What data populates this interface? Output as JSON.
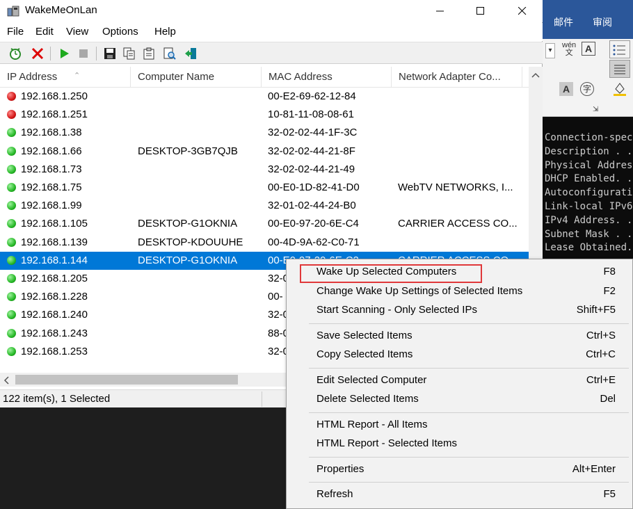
{
  "window": {
    "title": "WakeMeOnLan"
  },
  "menu": [
    "File",
    "Edit",
    "View",
    "Options",
    "Help"
  ],
  "toolbar": [
    "options-icon",
    "delete-icon",
    "play-icon",
    "stop-icon",
    "save-icon",
    "copy-icon",
    "properties-icon",
    "find-icon",
    "exit-icon"
  ],
  "columns": [
    "IP Address",
    "Computer Name",
    "MAC Address",
    "Network Adapter Co..."
  ],
  "rows": [
    {
      "status": "red",
      "ip": "192.168.1.250",
      "name": "",
      "mac": "00-E2-69-62-12-84",
      "adapter": ""
    },
    {
      "status": "red",
      "ip": "192.168.1.251",
      "name": "",
      "mac": "10-81-11-08-08-61",
      "adapter": ""
    },
    {
      "status": "green",
      "ip": "192.168.1.38",
      "name": "",
      "mac": "32-02-02-44-1F-3C",
      "adapter": ""
    },
    {
      "status": "green",
      "ip": "192.168.1.66",
      "name": "DESKTOP-3GB7QJB",
      "mac": "32-02-02-44-21-8F",
      "adapter": ""
    },
    {
      "status": "green",
      "ip": "192.168.1.73",
      "name": "",
      "mac": "32-02-02-44-21-49",
      "adapter": ""
    },
    {
      "status": "green",
      "ip": "192.168.1.75",
      "name": "",
      "mac": "00-E0-1D-82-41-D0",
      "adapter": "WebTV NETWORKS, I..."
    },
    {
      "status": "green",
      "ip": "192.168.1.99",
      "name": "",
      "mac": "32-01-02-44-24-B0",
      "adapter": ""
    },
    {
      "status": "green",
      "ip": "192.168.1.105",
      "name": "DESKTOP-G1OKNIA",
      "mac": "00-E0-97-20-6E-C4",
      "adapter": "CARRIER ACCESS CO..."
    },
    {
      "status": "green",
      "ip": "192.168.1.139",
      "name": "DESKTOP-KDOUUHE",
      "mac": "00-4D-9A-62-C0-71",
      "adapter": ""
    },
    {
      "status": "green",
      "ip": "192.168.1.144",
      "name": "DESKTOP-G1OKNIA",
      "mac": "00-E0-97-20-6E-C2",
      "adapter": "CARRIER ACCESS CO...",
      "selected": true
    },
    {
      "status": "green",
      "ip": "192.168.1.205",
      "name": "",
      "mac": "32-0",
      "adapter": ""
    },
    {
      "status": "green",
      "ip": "192.168.1.228",
      "name": "",
      "mac": "00-",
      "adapter": ""
    },
    {
      "status": "green",
      "ip": "192.168.1.240",
      "name": "",
      "mac": "32-0",
      "adapter": ""
    },
    {
      "status": "green",
      "ip": "192.168.1.243",
      "name": "",
      "mac": "88-0",
      "adapter": ""
    },
    {
      "status": "green",
      "ip": "192.168.1.253",
      "name": "",
      "mac": "32-0",
      "adapter": ""
    }
  ],
  "status": {
    "text": "122 item(s), 1 Selected"
  },
  "context_menu": [
    {
      "label": "Wake Up Selected Computers",
      "shortcut": "F8",
      "highlighted": true
    },
    {
      "label": "Change Wake Up Settings of Selected Items",
      "shortcut": "F2"
    },
    {
      "label": "Start Scanning - Only Selected IPs",
      "shortcut": "Shift+F5"
    },
    {
      "sep": true
    },
    {
      "label": "Save Selected Items",
      "shortcut": "Ctrl+S"
    },
    {
      "label": "Copy Selected Items",
      "shortcut": "Ctrl+C"
    },
    {
      "sep": true
    },
    {
      "label": "Edit Selected Computer",
      "shortcut": "Ctrl+E"
    },
    {
      "label": "Delete Selected Items",
      "shortcut": "Del"
    },
    {
      "sep": true
    },
    {
      "label": "HTML Report - All Items",
      "shortcut": ""
    },
    {
      "label": "HTML Report - Selected Items",
      "shortcut": ""
    },
    {
      "sep": true
    },
    {
      "label": "Properties",
      "shortcut": "Alt+Enter"
    },
    {
      "sep": true
    },
    {
      "label": "Refresh",
      "shortcut": "F5"
    }
  ],
  "background_app": {
    "tabs": [
      "邮件",
      "审阅"
    ],
    "console_lines": [
      "Connection-spec",
      "Description . .",
      "Physical Addres",
      "DHCP Enabled. .",
      "Autoconfigurati",
      "Link-local IPv6",
      "IPv4 Address. .",
      "Subnet Mask . .",
      "Lease Obtained."
    ]
  },
  "colors": {
    "selection": "#0078d7",
    "highlight_box": "#e0383a",
    "word_ribbon": "#2b579a"
  }
}
